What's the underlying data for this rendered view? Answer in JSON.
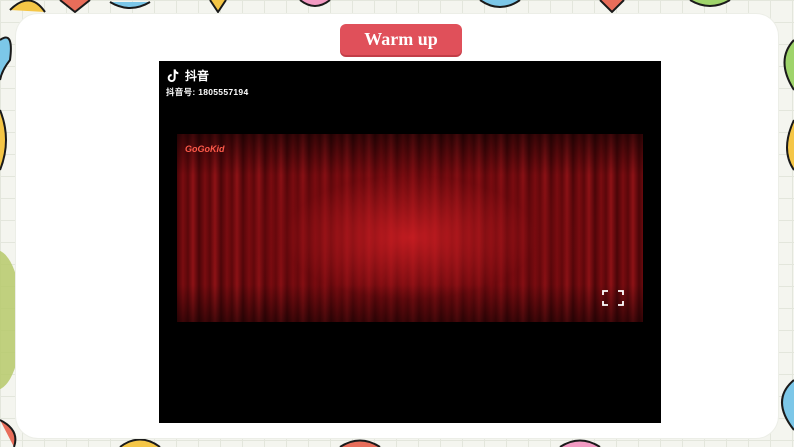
{
  "slide": {
    "title": "Warm up"
  },
  "video": {
    "platform_name": "抖音",
    "account_id": "抖音号: 1805557194",
    "brand_logo_text": "GoGoKid"
  },
  "colors": {
    "title_badge": "#e0505a",
    "curtain_red": "#b81a20",
    "background": "#f4f5ef"
  }
}
